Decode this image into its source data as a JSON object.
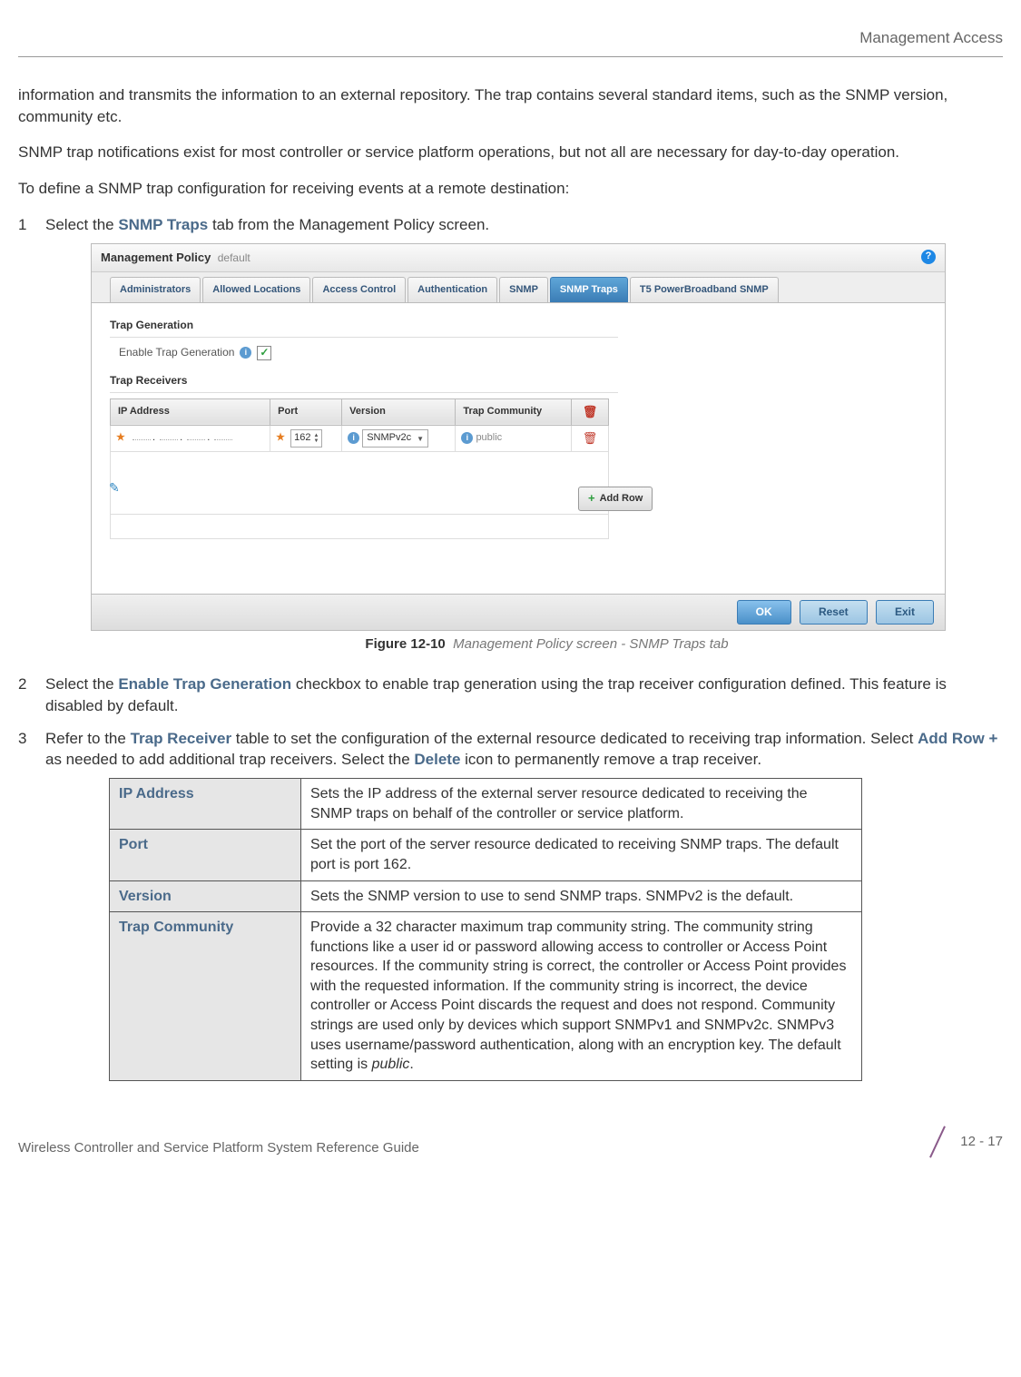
{
  "header": {
    "section": "Management Access"
  },
  "body": {
    "p1": "information and transmits the information to an external repository. The trap contains several standard items, such as the SNMP version, community etc.",
    "p2": "SNMP trap notifications exist for most controller or service platform operations, but not all are necessary for day-to-day operation.",
    "p3": "To define a SNMP trap configuration for receiving events at a remote destination:"
  },
  "steps": {
    "s1_pre": "Select the ",
    "s1_bold": "SNMP Traps",
    "s1_post": " tab from the Management Policy screen.",
    "s2_pre": "Select the ",
    "s2_bold": "Enable Trap Generation",
    "s2_post": " checkbox to enable trap generation using the trap receiver configuration defined. This feature is disabled by default.",
    "s3_pre": "Refer to the ",
    "s3_b1": "Trap Receiver",
    "s3_mid1": " table to set the configuration of the external resource dedicated to receiving trap information. Select ",
    "s3_b2": "Add Row +",
    "s3_mid2": " as needed to add additional trap receivers. Select the ",
    "s3_b3": "Delete",
    "s3_post": " icon to permanently remove a trap receiver."
  },
  "figure": {
    "title": "Management Policy",
    "subtitle": "default",
    "tabs": [
      "Administrators",
      "Allowed Locations",
      "Access Control",
      "Authentication",
      "SNMP",
      "SNMP Traps",
      "T5 PowerBroadband SNMP"
    ],
    "trap_gen_label": "Trap Generation",
    "enable_label": "Enable Trap Generation",
    "trap_recv_label": "Trap Receivers",
    "cols": {
      "ip": "IP Address",
      "port": "Port",
      "ver": "Version",
      "comm": "Trap Community"
    },
    "row": {
      "port": "162",
      "ver": "SNMPv2c",
      "comm": "public"
    },
    "addrow": "Add Row",
    "ok": "OK",
    "reset": "Reset",
    "exit": "Exit",
    "caption_num": "Figure 12-10",
    "caption_txt": "Management Policy screen - SNMP Traps tab"
  },
  "table": {
    "r1l": "IP Address",
    "r1d": "Sets the IP address of the external server resource dedicated to receiving the SNMP traps on behalf of the controller or service platform.",
    "r2l": "Port",
    "r2d": "Set the port of the server resource dedicated to receiving SNMP traps. The default port is port 162.",
    "r3l": "Version",
    "r3d": "Sets the SNMP version to use to send SNMP traps. SNMPv2 is the default.",
    "r4l": "Trap Community",
    "r4d_a": "Provide a 32 character maximum trap community string. The community string functions like a user id or password allowing access to controller or Access Point resources. If the community string is correct, the controller or Access Point provides with the requested information. If the community string is incorrect, the device controller or Access Point discards the request and does not respond. Community strings are used only by devices which support SNMPv1 and SNMPv2c. SNMPv3 uses username/password authentication, along with an encryption key. The default setting is ",
    "r4d_b": "public",
    "r4d_c": "."
  },
  "footer": {
    "guide": "Wireless Controller and Service Platform System Reference Guide",
    "page": "12 - 17"
  }
}
